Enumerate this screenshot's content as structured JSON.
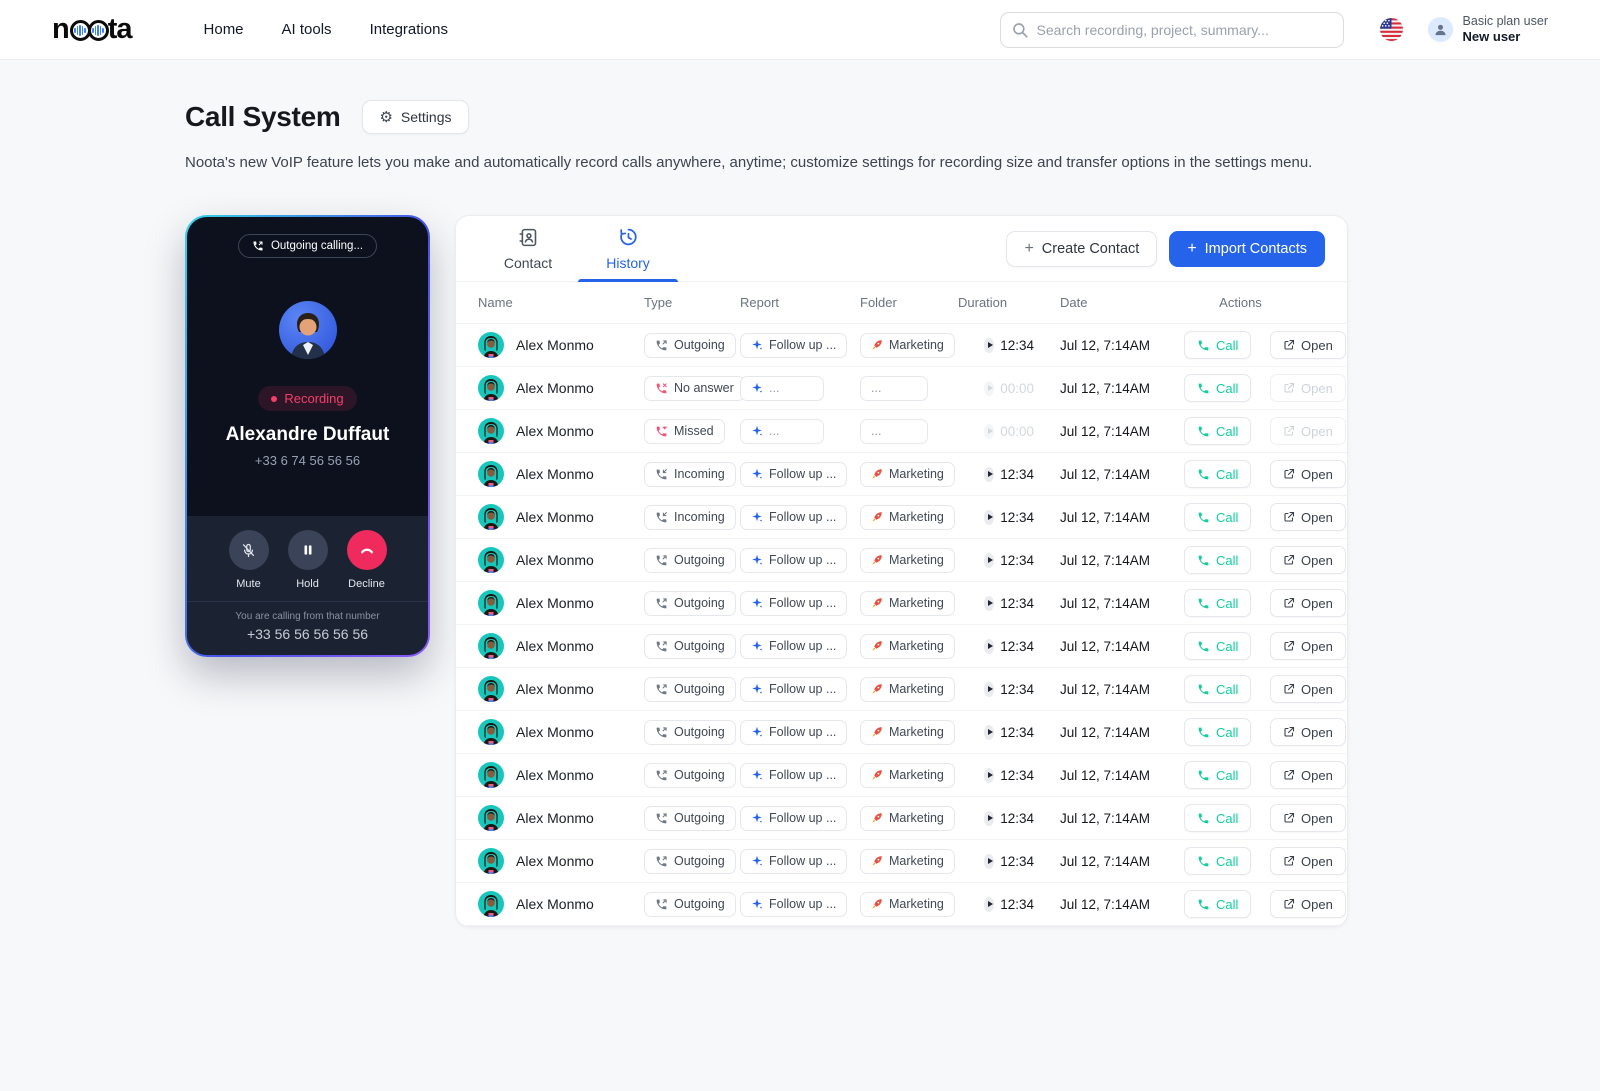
{
  "header": {
    "logo": {
      "full": "noota",
      "pre": "n",
      "post": "ta"
    },
    "nav": [
      {
        "label": "Home"
      },
      {
        "label": "AI tools"
      },
      {
        "label": "Integrations"
      }
    ],
    "search_placeholder": "Search recording, project, summary...",
    "user": {
      "plan": "Basic plan user",
      "name": "New user"
    }
  },
  "page": {
    "title": "Call System",
    "settings_label": "Settings",
    "description": "Noota's new VoIP feature lets you make and automatically record calls anywhere, anytime; customize settings for recording size and transfer options in the settings menu."
  },
  "phone": {
    "status_pill": "Outgoing calling...",
    "recording_label": "Recording",
    "contact_name": "Alexandre Duffaut",
    "contact_number": "+33 6 74 56 56 56",
    "controls": {
      "mute": "Mute",
      "hold": "Hold",
      "decline": "Decline"
    },
    "footer_note": "You are calling from that number",
    "footer_number": "+33 56 56 56 56 56"
  },
  "panel": {
    "tabs": [
      {
        "label": "Contact"
      },
      {
        "label": "History"
      }
    ],
    "active_tab": "History",
    "create_contact_label": "Create Contact",
    "import_contacts_label": "Import Contacts",
    "table": {
      "columns": [
        "Name",
        "Type",
        "Report",
        "Folder",
        "Duration",
        "Date",
        "Actions"
      ],
      "call_label": "Call",
      "open_label": "Open",
      "rows": [
        {
          "name": "Alex Monmo",
          "type": "Outgoing",
          "type_kind": "out",
          "report": "Follow up ...",
          "folder": "Marketing",
          "duration": "12:34",
          "date": "Jul 12, 7:14AM",
          "has_data": true
        },
        {
          "name": "Alex Monmo",
          "type": "No answer",
          "type_kind": "noanswer",
          "report": "...",
          "folder": "...",
          "duration": "00:00",
          "date": "Jul 12, 7:14AM",
          "has_data": false
        },
        {
          "name": "Alex Monmo",
          "type": "Missed",
          "type_kind": "missed",
          "report": "...",
          "folder": "...",
          "duration": "00:00",
          "date": "Jul 12, 7:14AM",
          "has_data": false
        },
        {
          "name": "Alex Monmo",
          "type": "Incoming",
          "type_kind": "in",
          "report": "Follow up ...",
          "folder": "Marketing",
          "duration": "12:34",
          "date": "Jul 12, 7:14AM",
          "has_data": true
        },
        {
          "name": "Alex Monmo",
          "type": "Incoming",
          "type_kind": "in",
          "report": "Follow up ...",
          "folder": "Marketing",
          "duration": "12:34",
          "date": "Jul 12, 7:14AM",
          "has_data": true
        },
        {
          "name": "Alex Monmo",
          "type": "Outgoing",
          "type_kind": "out",
          "report": "Follow up ...",
          "folder": "Marketing",
          "duration": "12:34",
          "date": "Jul 12, 7:14AM",
          "has_data": true
        },
        {
          "name": "Alex Monmo",
          "type": "Outgoing",
          "type_kind": "out",
          "report": "Follow up ...",
          "folder": "Marketing",
          "duration": "12:34",
          "date": "Jul 12, 7:14AM",
          "has_data": true
        },
        {
          "name": "Alex Monmo",
          "type": "Outgoing",
          "type_kind": "out",
          "report": "Follow up ...",
          "folder": "Marketing",
          "duration": "12:34",
          "date": "Jul 12, 7:14AM",
          "has_data": true
        },
        {
          "name": "Alex Monmo",
          "type": "Outgoing",
          "type_kind": "out",
          "report": "Follow up ...",
          "folder": "Marketing",
          "duration": "12:34",
          "date": "Jul 12, 7:14AM",
          "has_data": true
        },
        {
          "name": "Alex Monmo",
          "type": "Outgoing",
          "type_kind": "out",
          "report": "Follow up ...",
          "folder": "Marketing",
          "duration": "12:34",
          "date": "Jul 12, 7:14AM",
          "has_data": true
        },
        {
          "name": "Alex Monmo",
          "type": "Outgoing",
          "type_kind": "out",
          "report": "Follow up ...",
          "folder": "Marketing",
          "duration": "12:34",
          "date": "Jul 12, 7:14AM",
          "has_data": true
        },
        {
          "name": "Alex Monmo",
          "type": "Outgoing",
          "type_kind": "out",
          "report": "Follow up ...",
          "folder": "Marketing",
          "duration": "12:34",
          "date": "Jul 12, 7:14AM",
          "has_data": true
        },
        {
          "name": "Alex Monmo",
          "type": "Outgoing",
          "type_kind": "out",
          "report": "Follow up ...",
          "folder": "Marketing",
          "duration": "12:34",
          "date": "Jul 12, 7:14AM",
          "has_data": true
        },
        {
          "name": "Alex Monmo",
          "type": "Outgoing",
          "type_kind": "out",
          "report": "Follow up ...",
          "folder": "Marketing",
          "duration": "12:34",
          "date": "Jul 12, 7:14AM",
          "has_data": true
        }
      ]
    }
  },
  "colors": {
    "accent_blue": "#2563eb",
    "call_teal": "#12ce9e",
    "decline_red": "#ee2b5c",
    "recording_pink": "#f43f68"
  }
}
